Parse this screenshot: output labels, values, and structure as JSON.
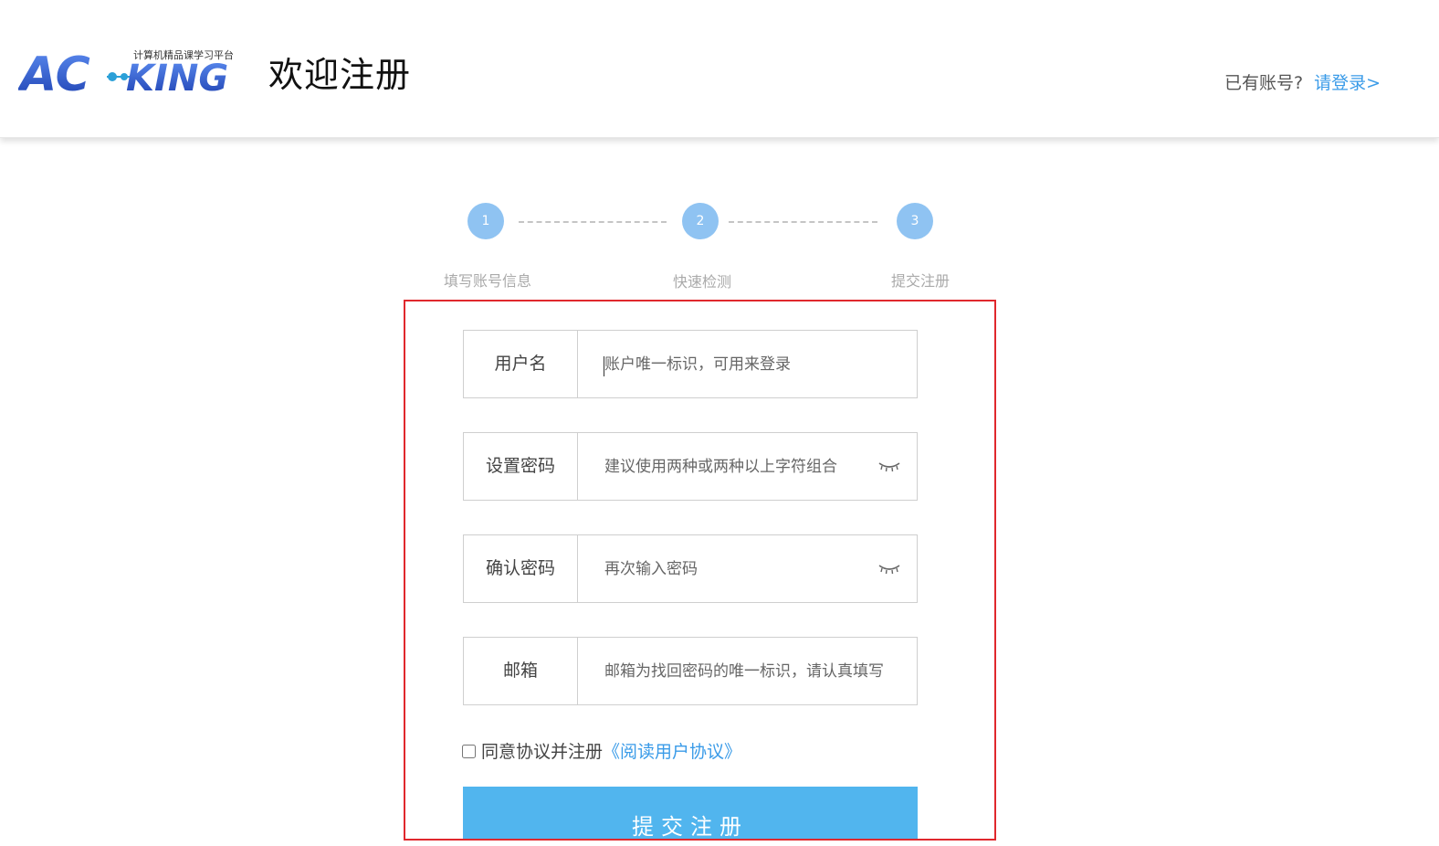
{
  "header": {
    "logo_text": "AC-KING",
    "logo_tagline": "计算机精品课学习平台",
    "title": "欢迎注册",
    "have_account": "已有账号?",
    "login_link": "请登录>"
  },
  "steps": [
    {
      "number": "1",
      "label": "填写账号信息"
    },
    {
      "number": "2",
      "label": "快速检测"
    },
    {
      "number": "3",
      "label": "提交注册"
    }
  ],
  "form": {
    "username": {
      "label": "用户名",
      "placeholder": "账户唯一标识，可用来登录",
      "value": ""
    },
    "password": {
      "label": "设置密码",
      "placeholder": "建议使用两种或两种以上字符组合",
      "value": ""
    },
    "confirm": {
      "label": "确认密码",
      "placeholder": "再次输入密码",
      "value": ""
    },
    "email": {
      "label": "邮箱",
      "placeholder": "邮箱为找回密码的唯一标识，请认真填写",
      "value": ""
    },
    "agree_text": "同意协议并注册",
    "agreement_link": "《阅读用户协议》",
    "agree_checked": false,
    "submit_label": "提交注册"
  },
  "colors": {
    "accent": "#3a9be8",
    "step_circle": "#8fc3f2",
    "submit": "#51b5ee",
    "frame": "#e0282d"
  },
  "icons": {
    "password_toggle": "closed-eye-icon"
  }
}
